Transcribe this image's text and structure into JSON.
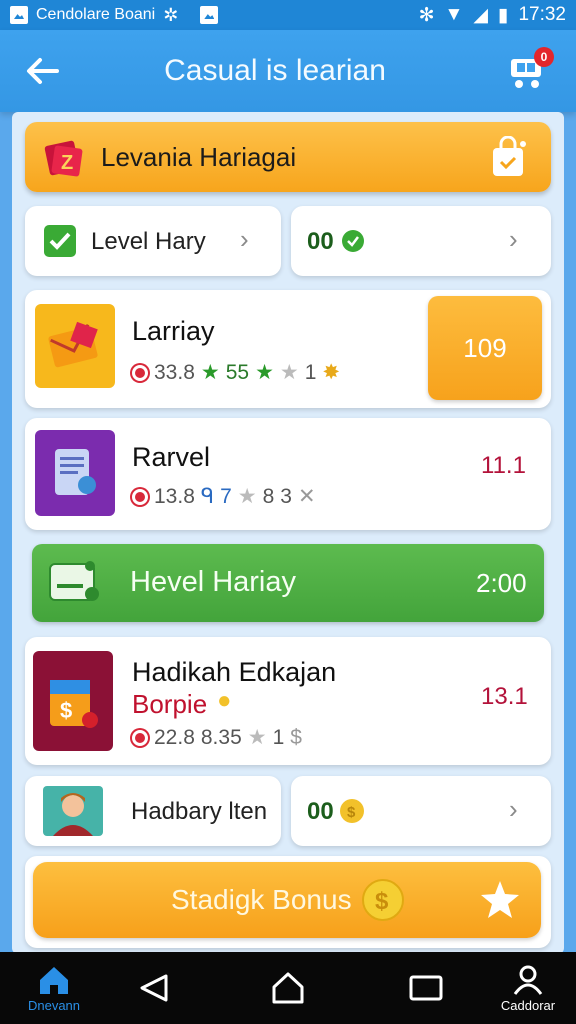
{
  "status_bar": {
    "app_name": "Cendolare Boani",
    "time": "17:32"
  },
  "app_bar": {
    "title": "Casual is learian",
    "cart_badge": "0"
  },
  "banner": {
    "title": "Levania Hariagai"
  },
  "pair_row_1": {
    "left_label": "Level Hary",
    "right_value": "00"
  },
  "items": [
    {
      "title": "Larriay",
      "meta_a": "33.8",
      "meta_b": "55",
      "meta_c": "1",
      "action_value": "109"
    },
    {
      "title": "Rarvel",
      "meta_a": "13.8",
      "meta_b": "7",
      "meta_c": "8",
      "meta_d": "3",
      "value": "11.1"
    }
  ],
  "green_bar": {
    "title": "Hevel Hariay",
    "value": "2:00"
  },
  "item3": {
    "title": "Hadikah Edkajan",
    "subtitle": "Borpie",
    "meta_a": "22.8",
    "meta_b": "8.35",
    "meta_c": "1",
    "value": "13.1"
  },
  "pair_row_2": {
    "left_label": "Hadbary lten",
    "right_value": "00"
  },
  "bonus_button": {
    "label": "Stadigk Bonus"
  },
  "bottom_nav": {
    "home_label": "Dnevann",
    "profile_label": "Caddorar"
  },
  "colors": {
    "primary": "#3497e4",
    "accent_orange": "#f7a51c",
    "green": "#4caf50",
    "red_value": "#b3123a"
  }
}
